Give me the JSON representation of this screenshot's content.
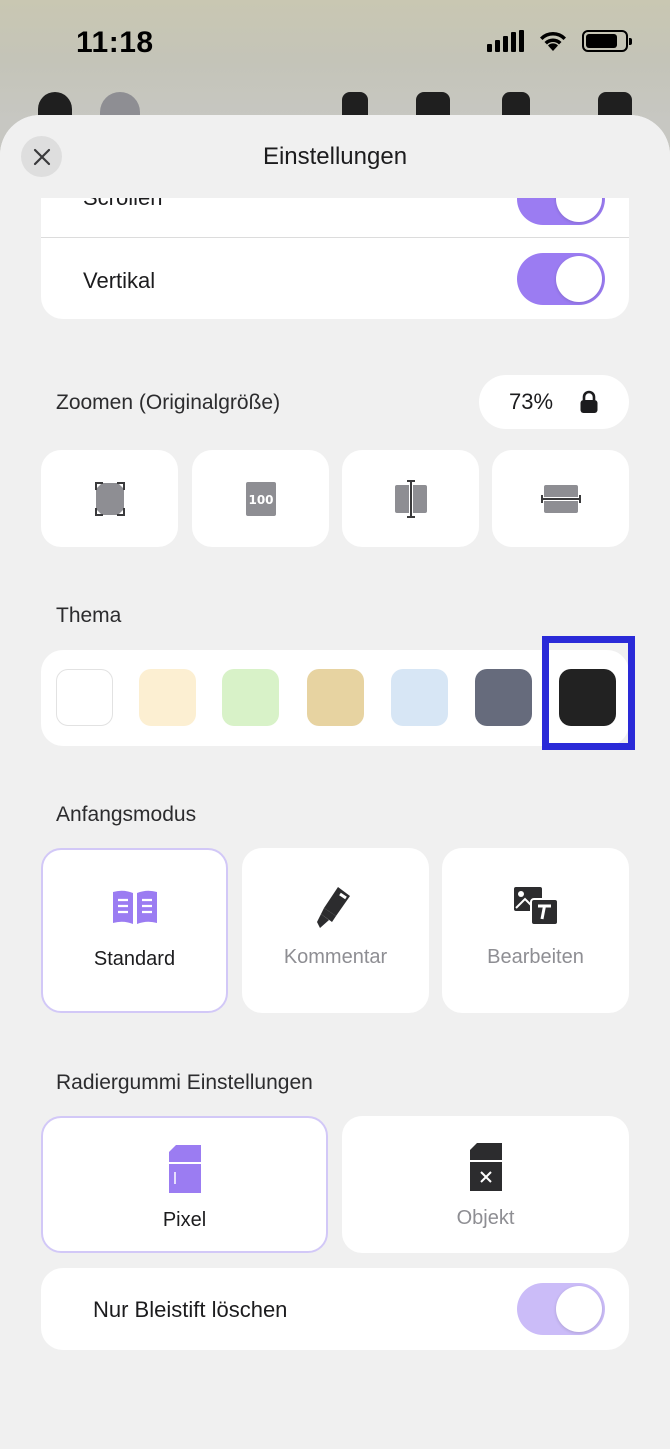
{
  "status_bar": {
    "time": "11:18"
  },
  "header": {
    "title": "Einstellungen"
  },
  "scroll_section": {
    "items": [
      {
        "label": "Scrollen",
        "on": true
      },
      {
        "label": "Vertikal",
        "on": true
      }
    ]
  },
  "zoom": {
    "label": "Zoomen (Originalgröße)",
    "value": "73%",
    "buttons": [
      "fit-page-icon",
      "actual-size-icon",
      "fit-width-icon",
      "fit-height-icon"
    ]
  },
  "theme": {
    "label": "Thema",
    "colors": [
      "#ffffff",
      "#fcefd2",
      "#d8f2c8",
      "#e7d3a1",
      "#d7e6f5",
      "#666b7c",
      "#222222"
    ],
    "selected_index": 6
  },
  "start_mode": {
    "label": "Anfangsmodus",
    "options": [
      {
        "label": "Standard",
        "icon": "book-icon",
        "selected": true
      },
      {
        "label": "Kommentar",
        "icon": "highlighter-icon",
        "selected": false
      },
      {
        "label": "Bearbeiten",
        "icon": "edit-image-text-icon",
        "selected": false
      }
    ]
  },
  "eraser": {
    "label": "Radiergummi Einstellungen",
    "options": [
      {
        "label": "Pixel",
        "icon": "pixel-eraser-icon",
        "selected": true
      },
      {
        "label": "Objekt",
        "icon": "object-eraser-icon",
        "selected": false
      }
    ],
    "pencil_only": {
      "label": "Nur Bleistift löschen",
      "on": true
    }
  },
  "colors": {
    "accent": "#9b7cf2",
    "accent_light": "#cbbcf8",
    "selection_outline": "#2a2ad8"
  }
}
